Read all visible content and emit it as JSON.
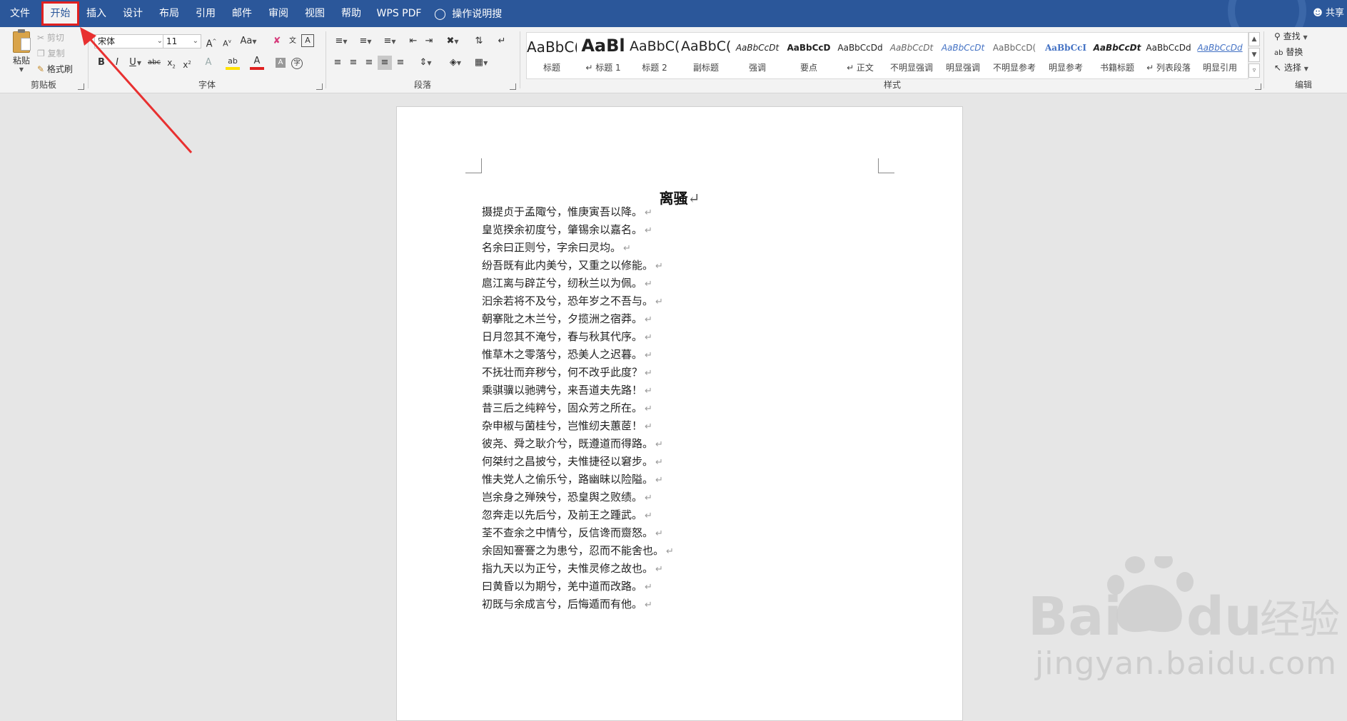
{
  "tabs": [
    {
      "label": "文件"
    },
    {
      "label": "开始"
    },
    {
      "label": "插入"
    },
    {
      "label": "设计"
    },
    {
      "label": "布局"
    },
    {
      "label": "引用"
    },
    {
      "label": "邮件"
    },
    {
      "label": "审阅"
    },
    {
      "label": "视图"
    },
    {
      "label": "帮助"
    },
    {
      "label": "WPS PDF"
    },
    {
      "label": "操作说明搜索"
    }
  ],
  "active_tab": "开始",
  "user": {
    "label": "共享"
  },
  "clipboard": {
    "paste": "粘贴",
    "cut": "剪切",
    "copy": "复制",
    "format_painter": "格式刷",
    "group": "剪贴板"
  },
  "font": {
    "name": "宋体",
    "size": "11",
    "group": "字体"
  },
  "paragraph": {
    "group": "段落"
  },
  "styles": {
    "group": "样式",
    "items": [
      {
        "preview": "AaBbC(",
        "name": "标题"
      },
      {
        "preview": "AaBl",
        "name": "↵ 标题 1"
      },
      {
        "preview": "AaBbC(",
        "name": "标题 2"
      },
      {
        "preview": "AaBbC(",
        "name": "副标题"
      },
      {
        "preview": "AaBbCcDt",
        "name": "强调"
      },
      {
        "preview": "AaBbCcD",
        "name": "要点"
      },
      {
        "preview": "AaBbCcDd",
        "name": "↵ 正文"
      },
      {
        "preview": "AaBbCcDt",
        "name": "不明显强调"
      },
      {
        "preview": "AaBbCcDt",
        "name": "明显强调"
      },
      {
        "preview": "AaBbCcD(",
        "name": "不明显参考"
      },
      {
        "preview": "AaBbCcI",
        "name": "明显参考"
      },
      {
        "preview": "AaBbCcDt",
        "name": "书籍标题"
      },
      {
        "preview": "AaBbCcDd",
        "name": "↵ 列表段落"
      },
      {
        "preview": "AaBbCcDd",
        "name": "明显引用"
      }
    ]
  },
  "editing": {
    "find": "查找",
    "replace": "替换",
    "select": "选择",
    "group": "编辑"
  },
  "document": {
    "title": "离骚",
    "paragraph_mark": "↵",
    "lines": [
      "摄提贞于孟陬兮，惟庚寅吾以降。",
      "皇览揆余初度兮，肇锡余以嘉名。",
      "名余曰正则兮，字余曰灵均。",
      "纷吾既有此内美兮，又重之以修能。",
      "扈江离与辟芷兮，纫秋兰以为佩。",
      "汩余若将不及兮，恐年岁之不吾与。",
      "朝搴阰之木兰兮，夕揽洲之宿莽。",
      "日月忽其不淹兮，春与秋其代序。",
      "惟草木之零落兮，恐美人之迟暮。",
      "不抚壮而弃秽兮，何不改乎此度？",
      "乘骐骥以驰骋兮，来吾道夫先路！",
      "昔三后之纯粹兮，固众芳之所在。",
      "杂申椒与菌桂兮，岂惟纫夫蕙茝！",
      "彼尧、舜之耿介兮，既遵道而得路。",
      "何桀纣之昌披兮，夫惟捷径以窘步。",
      "惟夫党人之偷乐兮，路幽昧以险隘。",
      "岂余身之殚殃兮，恐皇舆之败绩。",
      "忽奔走以先后兮，及前王之踵武。",
      "荃不查余之中情兮，反信谗而齌怒。",
      "余固知謇謇之为患兮，忍而不能舍也。",
      "指九天以为正兮，夫惟灵修之故也。",
      "曰黄昏以为期兮，羌中道而改路。",
      "初既与余成言兮，后悔遁而有他。"
    ]
  },
  "watermark": {
    "brand": "Baidu经验",
    "url": "jingyan.baidu.com"
  },
  "colors": {
    "tab_bar": "#2b579a",
    "highlight": "#e02020",
    "ribbon": "#f3f3f3"
  }
}
